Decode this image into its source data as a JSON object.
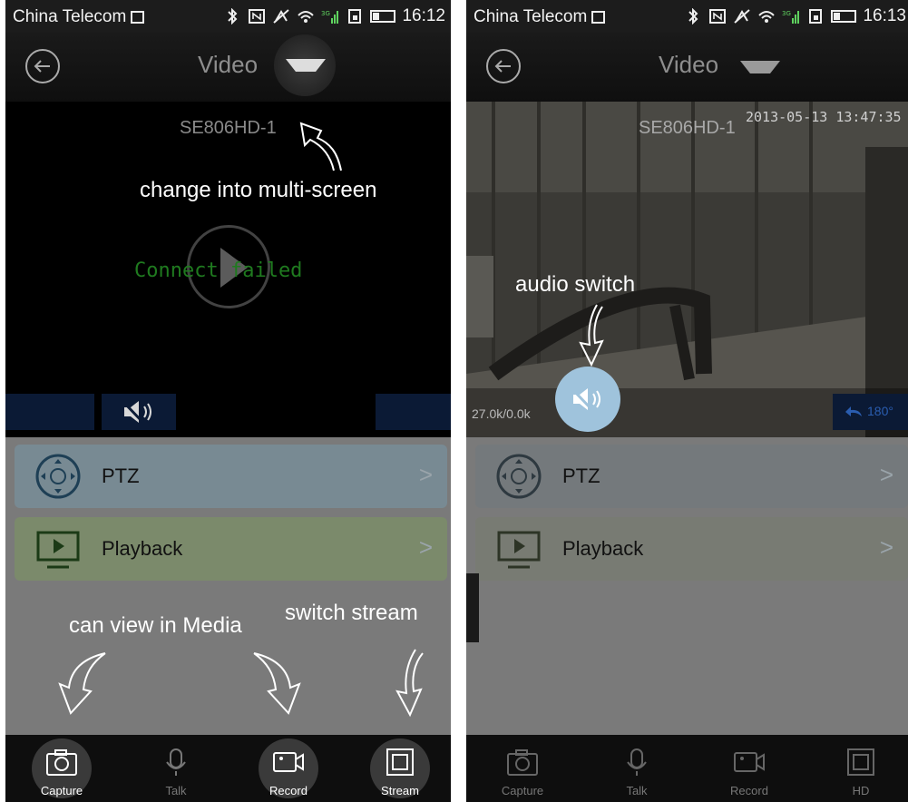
{
  "status_left": {
    "carrier": "China Telecom",
    "time": "16:12",
    "signal": "3G 2G"
  },
  "status_right": {
    "carrier": "China Telecom",
    "time": "16:13",
    "signal": "3G 2G"
  },
  "header": {
    "title": "Video"
  },
  "camera_name": "SE806HD-1",
  "left_video": {
    "error_text": "Connect failed"
  },
  "right_video": {
    "timestamp": "2013-05-13 13:47:35",
    "rate": "27.0k/0.0k",
    "rotate": "180°"
  },
  "annotations": {
    "multi_screen": "change into multi-screen",
    "media": "can view in Media",
    "stream": "switch stream",
    "audio": "audio switch"
  },
  "menu": {
    "ptz": "PTZ",
    "playback": "Playback"
  },
  "toolbar": {
    "capture": "Capture",
    "talk": "Talk",
    "record": "Record",
    "stream": "Stream",
    "hd": "HD"
  },
  "colors": {
    "accent_orange": "#f27b1f",
    "menu_ptz": "#788a93",
    "menu_playback": "#7b8a6b",
    "error_green": "#1f7a1f"
  },
  "icons": [
    "back-icon",
    "dropdown-icon",
    "mute-icon",
    "ptz-icon",
    "playback-icon",
    "camera-icon",
    "mic-icon",
    "video-icon",
    "stream-icon",
    "rotate-icon",
    "bluetooth-icon",
    "nfc-icon",
    "wifi-icon",
    "battery-icon"
  ]
}
